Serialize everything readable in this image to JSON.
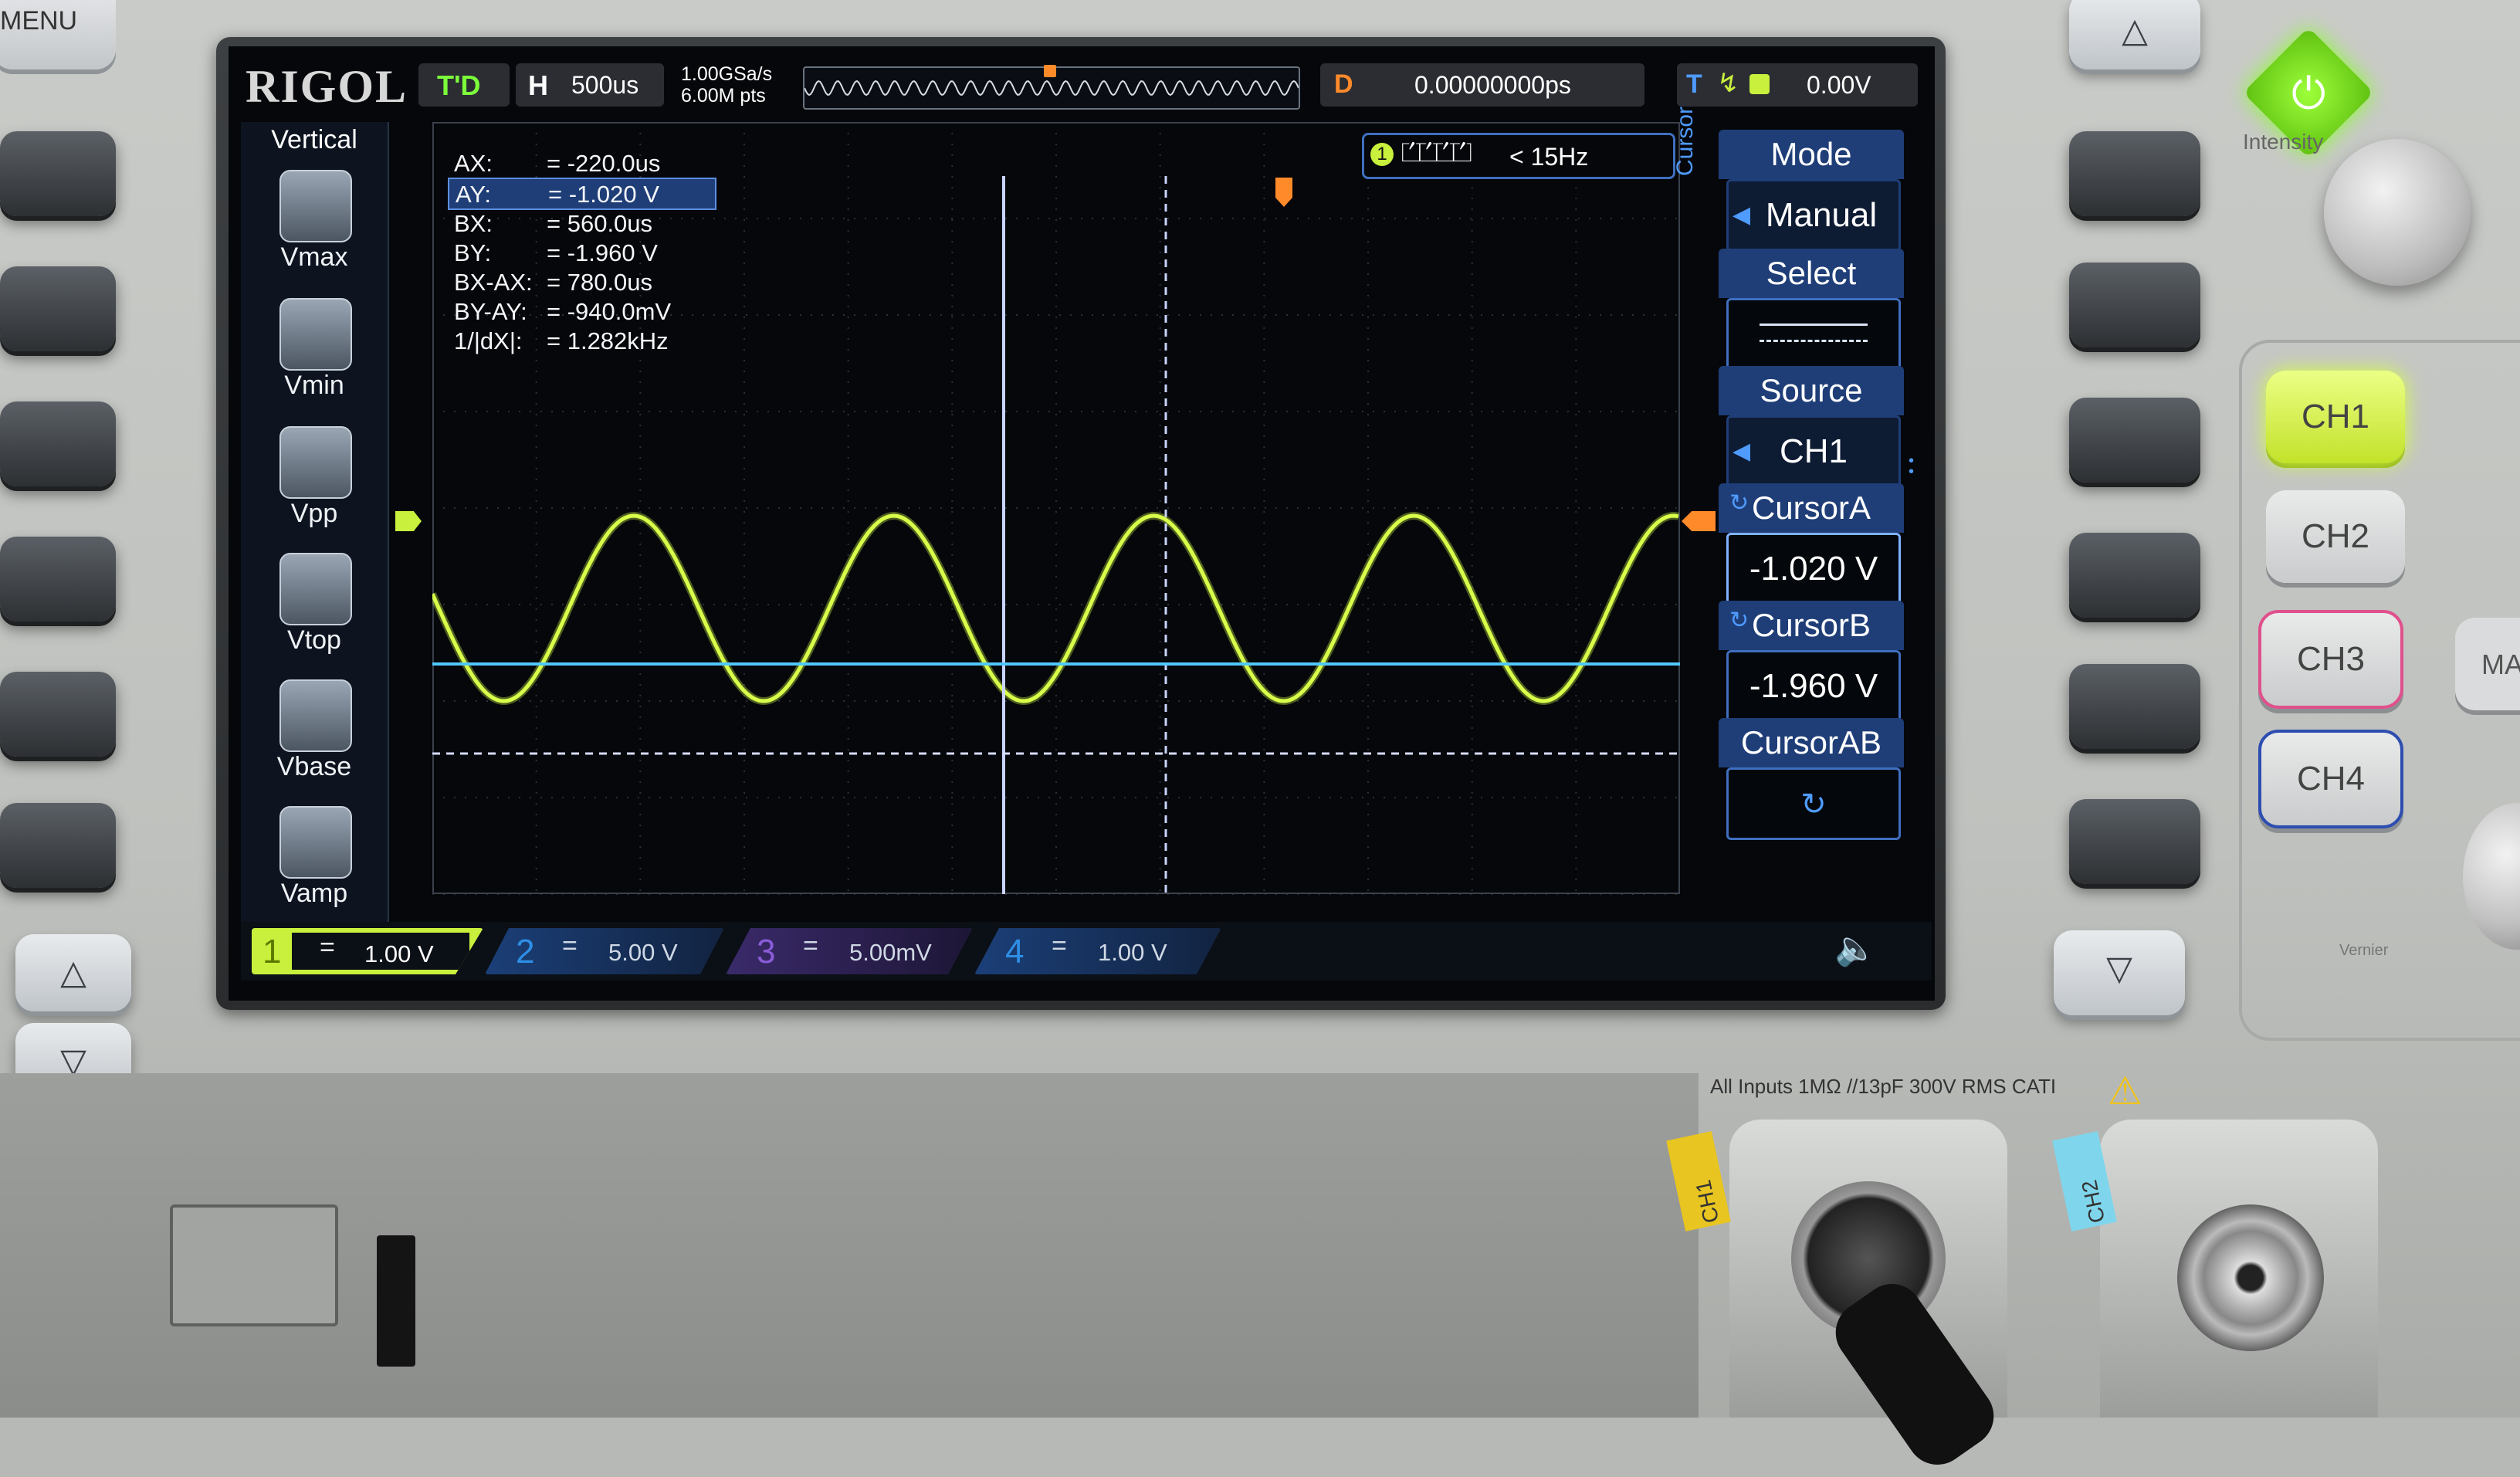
{
  "device": {
    "panel_labels": {
      "menu": "MENU",
      "intensity": "Intensity",
      "inputs_warning": "All Inputs 1MΩ //13pF 300V RMS   CATI",
      "vernier": "Vernier",
      "partial_button": "MA"
    },
    "channel_buttons": [
      "CH1",
      "CH2",
      "CH3",
      "CH4"
    ],
    "bnc_labels": [
      "CH1",
      "CH2"
    ]
  },
  "screen": {
    "brand": "RIGOL",
    "run_state": "T'D",
    "horizontal": {
      "label": "H",
      "timebase": "500us"
    },
    "acquisition": {
      "sample_rate": "1.00GSa/s",
      "memory_depth": "6.00M pts"
    },
    "delay": {
      "label": "D",
      "value": "0.00000000ps"
    },
    "trigger": {
      "label": "T",
      "level": "0.00V"
    },
    "freq_counter": {
      "channel": "1",
      "value": "< 15Hz"
    },
    "vertical_menu": {
      "title": "Vertical",
      "items": [
        "Vmax",
        "Vmin",
        "Vpp",
        "Vtop",
        "Vbase",
        "Vamp"
      ]
    },
    "cursor_readout": [
      {
        "label": "AX:",
        "value": "= -220.0us"
      },
      {
        "label": "AY:",
        "value": "= -1.020 V"
      },
      {
        "label": "BX:",
        "value": "= 560.0us"
      },
      {
        "label": "BY:",
        "value": "= -1.960 V"
      },
      {
        "label": "BX-AX:",
        "value": "= 780.0us"
      },
      {
        "label": "BY-AY:",
        "value": "= -940.0mV"
      },
      {
        "label": "1/|dX|:",
        "value": "= 1.282kHz"
      }
    ],
    "cursor_menu": {
      "side_label": "Cursor",
      "mode_title": "Mode",
      "mode_value": "Manual",
      "select_title": "Select",
      "source_title": "Source",
      "source_value": "CH1",
      "cursor_a_title": "CursorA",
      "cursor_a_value": "-1.020 V",
      "cursor_b_title": "CursorB",
      "cursor_b_value": "-1.960 V",
      "cursor_ab_title": "CursorAB"
    },
    "channels": [
      {
        "num": "1",
        "coupling": "=",
        "scale": "1.00 V",
        "color": "#c8f03c"
      },
      {
        "num": "2",
        "coupling": "=",
        "scale": "5.00 V",
        "color": "#2f8fe6"
      },
      {
        "num": "3",
        "coupling": "=",
        "scale": "5.00mV",
        "color": "#8a5cd8"
      },
      {
        "num": "4",
        "coupling": "=",
        "scale": "1.00 V",
        "color": "#2f8fe6"
      }
    ],
    "waveform": {
      "cycles_shown": 4.8,
      "color": "#d8ff4a"
    },
    "markers": {
      "ch1": "1",
      "trigger": "T"
    }
  },
  "colors": {
    "waveform": "#d8ff4a",
    "cursor_a_h": "#4fc8ff",
    "cursor_b_h": "#d8dcff",
    "menu_blue": "#1f3e78"
  }
}
